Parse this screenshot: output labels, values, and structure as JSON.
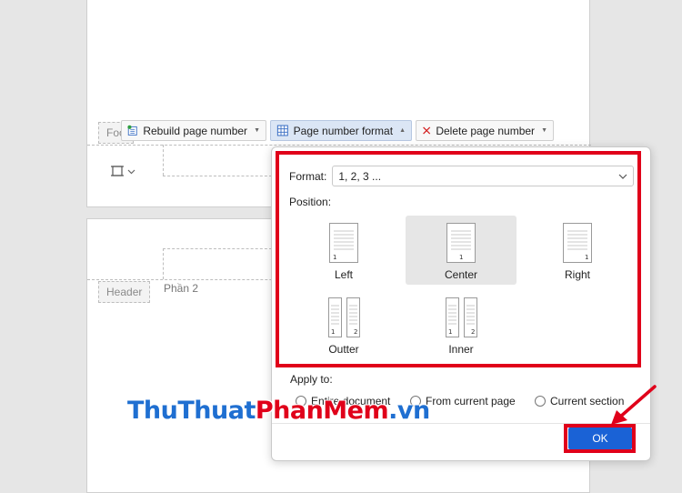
{
  "toolbar": {
    "rebuild_label": "Rebuild page number",
    "format_label": "Page number format",
    "delete_label": "Delete page number"
  },
  "document": {
    "footer_tag": "Foo",
    "header_tag": "Header",
    "section_label": "Phần 2"
  },
  "dialog": {
    "format_label": "Format:",
    "format_value": "1, 2, 3 ...",
    "position_label": "Position:",
    "positions": [
      {
        "label": "Left",
        "selected": false
      },
      {
        "label": "Center",
        "selected": true
      },
      {
        "label": "Right",
        "selected": false
      },
      {
        "label": "Outter",
        "selected": false
      },
      {
        "label": "Inner",
        "selected": false
      }
    ],
    "apply_label": "Apply to:",
    "apply_options": [
      "Entire document",
      "From current page",
      "Current section"
    ],
    "ok_label": "OK"
  },
  "thumb_numbers": {
    "one": "1",
    "two": "2"
  },
  "watermark": {
    "part1": "ThuThuat",
    "part2": "PhanMem",
    "part3": ".vn",
    "color1": "#1f6fd1",
    "color2": "#e0001a",
    "color3": "#1f6fd1"
  },
  "colors": {
    "highlight": "#e0001a",
    "ok_button": "#1a62d6",
    "selected_bg": "#e6e6e6"
  }
}
